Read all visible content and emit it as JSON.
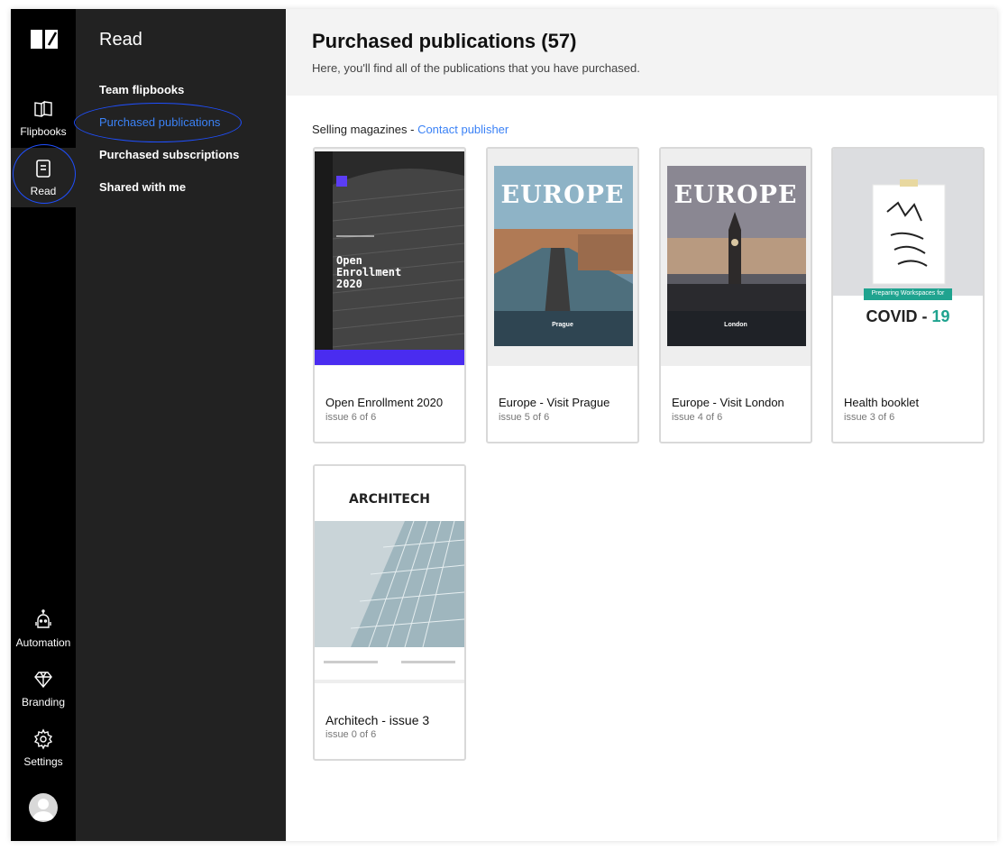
{
  "rail": {
    "items": [
      {
        "label": "Flipbooks",
        "icon": "book-icon"
      },
      {
        "label": "Read",
        "icon": "read-icon",
        "active": true
      },
      {
        "label": "Automation",
        "icon": "robot-icon"
      },
      {
        "label": "Branding",
        "icon": "diamond-icon"
      },
      {
        "label": "Settings",
        "icon": "gear-icon"
      }
    ]
  },
  "subnav": {
    "title": "Read",
    "items": [
      {
        "label": "Team flipbooks"
      },
      {
        "label": "Purchased publications",
        "active": true
      },
      {
        "label": "Purchased subscriptions"
      },
      {
        "label": "Shared with me"
      }
    ]
  },
  "main": {
    "title": "Purchased publications (57)",
    "subtitle": "Here, you'll find all of the publications that you have purchased.",
    "section_prefix": "Selling magazines - ",
    "section_link": "Contact publisher",
    "publications": [
      {
        "title": "Open Enrollment 2020",
        "issue": "issue 6 of 6",
        "cover_text": "Open\nEnrollment\n2020"
      },
      {
        "title": "Europe - Visit Prague",
        "issue": "issue 5 of 6",
        "cover_text": "EUROPE",
        "cover_caption": "Prague"
      },
      {
        "title": "Europe - Visit London",
        "issue": "issue 4 of 6",
        "cover_text": "EUROPE",
        "cover_caption": "London"
      },
      {
        "title": "Health booklet",
        "issue": "issue 3 of 6",
        "cover_banner": "Preparing Workspaces for",
        "cover_text": "COVID - ",
        "cover_text_accent": "19"
      },
      {
        "title": "Architech - issue 3",
        "issue": "issue 0 of 6",
        "cover_text": "ARCHITECH"
      }
    ]
  },
  "colors": {
    "rail_bg": "#000000",
    "subnav_bg": "#222222",
    "accent": "#3b82f6",
    "highlight_circle": "#1f4fff",
    "header_bg": "#f3f3f3"
  }
}
